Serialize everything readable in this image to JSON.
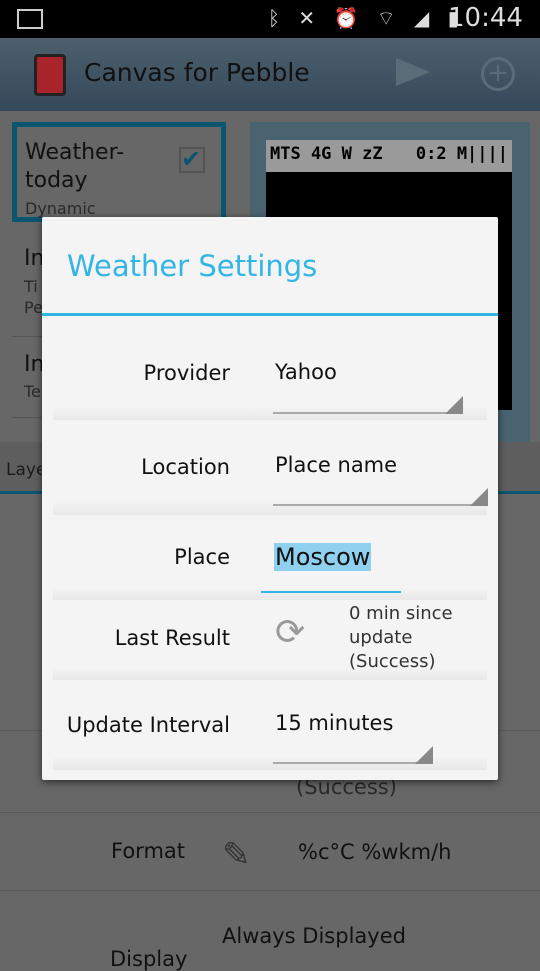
{
  "status_bar": {
    "time": "10:44",
    "icons": [
      "image-icon",
      "bluetooth-icon",
      "mute-icon",
      "alarm-icon",
      "wifi-icon",
      "signal-icon",
      "battery-icon"
    ]
  },
  "app_bar": {
    "title": "Canvas for Pebble",
    "actions": [
      "send-icon",
      "add-icon"
    ]
  },
  "layers": [
    {
      "title": "Weather-\ntoday",
      "subtitle": "Dynamic",
      "checked": true,
      "selected": true
    },
    {
      "title": "In",
      "subtitle": "Ti\nPe"
    },
    {
      "title": "In",
      "subtitle": "Te"
    }
  ],
  "preview": {
    "status_left": "MTS 4G W zZ",
    "status_right": "0:2 M||||"
  },
  "tab_label": "Laye",
  "background_rows": {
    "last_result_tail": "(Success)",
    "format_label": "Format",
    "format_value": "%c°C %wkm/h",
    "display_label": "Display",
    "display_value": "Always Displayed"
  },
  "dialog": {
    "title": "Weather Settings",
    "accent": "#33b5e5",
    "provider": {
      "label": "Provider",
      "value": "Yahoo"
    },
    "location": {
      "label": "Location",
      "value": "Place name"
    },
    "place": {
      "label": "Place",
      "value": "Moscow"
    },
    "last_result": {
      "label": "Last Result",
      "value": "0 min since\nupdate\n(Success)"
    },
    "update_interval": {
      "label": "Update Interval",
      "value": "15 minutes"
    }
  }
}
